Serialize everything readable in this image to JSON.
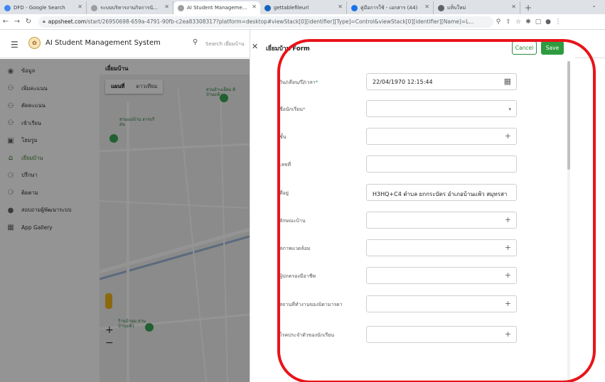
{
  "browser": {
    "tabs": [
      {
        "label": "DFD - Google Search",
        "icon": "google-icon",
        "color": "#4285f4",
        "active": false
      },
      {
        "label": "ระบบบริหารงานกิจการนักเรีย",
        "icon": "page-icon",
        "color": "#9e9e9e",
        "active": false
      },
      {
        "label": "AI Student Management S",
        "icon": "page-icon",
        "color": "#9e9e9e",
        "active": true
      },
      {
        "label": "gettablefileurl",
        "icon": "appsheet-icon",
        "color": "#1565c0",
        "active": false
      },
      {
        "label": "คู่มือการใช้ - เอกสาร (A4)",
        "icon": "docs-icon",
        "color": "#1a73e8",
        "active": false
      },
      {
        "label": "แท็บใหม่",
        "icon": "chrome-icon",
        "color": "#5f6368",
        "active": false
      }
    ],
    "url_host": "appsheet.com",
    "url_rest": "/start/26950698-659a-4791-90fb-c2ea83308317?platform=desktop#viewStack[0][identifier][Type]=Control&viewStack[0][identifier][Name]=L..."
  },
  "app": {
    "title": "AI Student Management System",
    "search_placeholder": "Search เยี่ยมบ้าน"
  },
  "sidebar": {
    "items": [
      {
        "label": "ข้อมูล",
        "icon": "person-circle-icon",
        "selected": false
      },
      {
        "label": "เพิ่มคะแนน",
        "icon": "person-add-icon",
        "selected": false
      },
      {
        "label": "ตัดคะแนน",
        "icon": "person-remove-icon",
        "selected": false
      },
      {
        "label": "เข้าเรียน",
        "icon": "group-icon",
        "selected": false
      },
      {
        "label": "โฮมรูม",
        "icon": "classroom-icon",
        "selected": false
      },
      {
        "label": "เยี่ยมบ้าน",
        "icon": "home-visit-icon",
        "selected": true
      },
      {
        "label": "ปรึกษา",
        "icon": "consult-icon",
        "selected": false
      },
      {
        "label": "ติดตาม",
        "icon": "follow-icon",
        "selected": false
      },
      {
        "label": "สอบถามผู้พัฒนาระบบ",
        "icon": "info-icon",
        "selected": false
      },
      {
        "label": "App Gallery",
        "icon": "grid-icon",
        "selected": false
      }
    ]
  },
  "map": {
    "view_title": "เยี่ยมบ้าน",
    "tab_map": "แผนที่",
    "tab_satellite": "ดาวเทียม",
    "place1": "สวนล้านเยี่ยม ติบ้านแพ้ว",
    "place2": "สวนแม่บ้าน ฮารบรีสน",
    "place3": "ร้านบ้านม สวน บ้านแพ้ว"
  },
  "form": {
    "title": "เยี่ยมบ้าน Form",
    "cancel_label": "Cancel",
    "save_label": "Save",
    "fields": [
      {
        "label": "วัน/เดือน/ปี/เวลา",
        "required": true,
        "value": "22/04/1970 12:15:44",
        "icon": "calendar-icon",
        "glyph": "▦"
      },
      {
        "label": "ชื่อนักเรียน",
        "required": true,
        "value": "",
        "icon": "dropdown-icon",
        "glyph": "▾"
      },
      {
        "label": "ชั้น",
        "required": false,
        "value": "",
        "icon": "plus-icon",
        "glyph": "+"
      },
      {
        "label": "เลขที่",
        "required": false,
        "value": "",
        "icon": "",
        "glyph": ""
      },
      {
        "label": "ที่อยู่",
        "required": false,
        "value": "H3HQ+C4 ตำบล ยกกระบัตร อำเภอบ้านแพ้ว สมุทรสาคร",
        "icon": "",
        "glyph": ""
      },
      {
        "label": "ลักษณะบ้าน",
        "required": false,
        "value": "",
        "icon": "plus-icon",
        "glyph": "+"
      },
      {
        "label": "สภาพแวดล้อม",
        "required": false,
        "value": "",
        "icon": "plus-icon",
        "glyph": "+"
      },
      {
        "label": "ผู้ปกครองมีอาชีพ",
        "required": false,
        "value": "",
        "icon": "plus-icon",
        "glyph": "+"
      },
      {
        "label": "สถานที่ทำงานของบิดามารดา",
        "required": false,
        "value": "",
        "icon": "plus-icon",
        "glyph": "+"
      },
      {
        "label": "โรคประจำตัวของนักเรียน",
        "required": false,
        "value": "",
        "icon": "plus-icon",
        "glyph": "+"
      }
    ]
  },
  "colors": {
    "accent": "#2e9b40",
    "annotation": "#e8141a"
  }
}
